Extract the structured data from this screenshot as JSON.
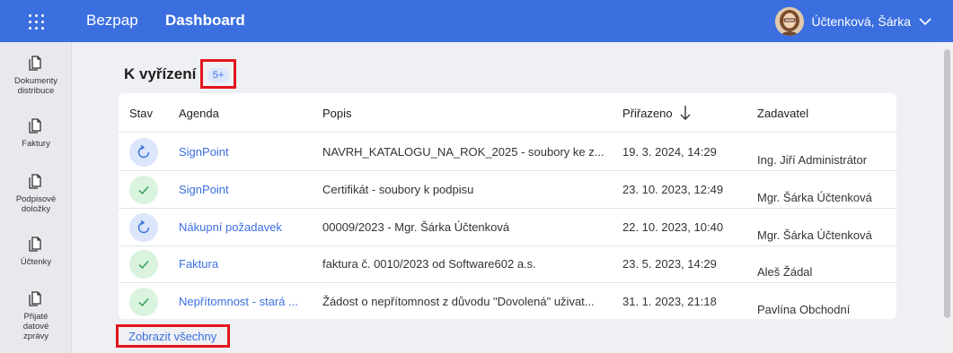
{
  "header": {
    "brand": "Bezpap",
    "title": "Dashboard",
    "user_name": "Účtenková, Šárka"
  },
  "sidebar": {
    "items": [
      {
        "label_line1": "Dokumenty",
        "label_line2": "distribuce",
        "label_line3": ""
      },
      {
        "label_line1": "Faktury",
        "label_line2": "",
        "label_line3": ""
      },
      {
        "label_line1": "Podpisové",
        "label_line2": "doložky",
        "label_line3": ""
      },
      {
        "label_line1": "Účtenky",
        "label_line2": "",
        "label_line3": ""
      },
      {
        "label_line1": "Přijaté",
        "label_line2": "datové",
        "label_line3": "zprávy"
      }
    ]
  },
  "section": {
    "title": "K vyřízení",
    "count_badge": "5+",
    "show_all": "Zobrazit všechny"
  },
  "table": {
    "columns": [
      "Stav",
      "Agenda",
      "Popis",
      "Přiřazeno",
      "Zadavatel"
    ],
    "rows": [
      {
        "status": "in-progress",
        "agenda": "SignPoint",
        "popis": "NAVRH_KATALOGU_NA_ROK_2025 - soubory ke z...",
        "prirazeno": "19. 3. 2024, 14:29",
        "zadavatel": "Ing. Jiří Administrátor"
      },
      {
        "status": "done",
        "agenda": "SignPoint",
        "popis": "Certifikát - soubory k podpisu",
        "prirazeno": "23. 10. 2023, 12:49",
        "zadavatel": "Mgr. Šárka Účtenková"
      },
      {
        "status": "in-progress",
        "agenda": "Nákupní požadavek",
        "popis": "00009/2023 - Mgr. Šárka Účtenková",
        "prirazeno": "22. 10. 2023, 10:40",
        "zadavatel": "Mgr. Šárka Účtenková"
      },
      {
        "status": "done",
        "agenda": "Faktura",
        "popis": "faktura č. 0010/2023 od Software602 a.s.",
        "prirazeno": "23. 5. 2023, 14:29",
        "zadavatel": "Aleš Žádal"
      },
      {
        "status": "done",
        "agenda": "Nepřítomnost - stará ...",
        "popis": "Žádost o nepřítomnost z důvodu \"Dovolená\" uživat...",
        "prirazeno": "31. 1. 2023, 21:18",
        "zadavatel": "Pavlína Obchodní"
      }
    ]
  },
  "colors": {
    "accent": "#3b6fe0",
    "highlight": "#e3161d",
    "status_progress_bg": "#dbe6fb",
    "status_done_bg": "#daf3df",
    "status_done_icon": "#2e9a4c"
  },
  "icons": {
    "apps": "apps-grid-icon",
    "chevron": "chevron-down-icon",
    "sidebar": "document-icon",
    "sort": "arrow-down-icon",
    "status_progress": "refresh-icon",
    "status_done": "check-icon"
  }
}
